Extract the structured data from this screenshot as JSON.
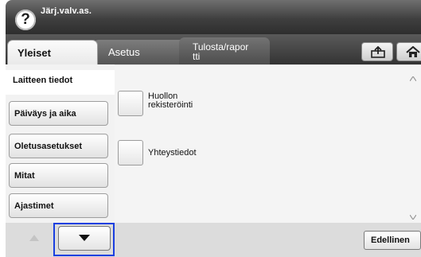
{
  "header": {
    "help_symbol": "?",
    "title": "Järj.valv.as."
  },
  "tabs": [
    {
      "label": "Yleiset",
      "selected": true
    },
    {
      "label": "Asetus"
    },
    {
      "label_line1": "Tulosta/rapor",
      "label_line2": "tti"
    }
  ],
  "toolbar": {
    "icons": [
      "export-tray-icon",
      "home-icon"
    ]
  },
  "menu": {
    "items": [
      {
        "label": "Laitteen tiedot",
        "selected": true
      },
      {
        "label": "Päiväys ja aika"
      },
      {
        "label": "Oletusasetukset"
      },
      {
        "label": "Mitat"
      },
      {
        "label": "Ajastimet"
      }
    ]
  },
  "content": {
    "items": [
      {
        "line1": "Huollon",
        "line2": "rekisteröinti"
      },
      {
        "line1": "Yhteystiedot"
      }
    ]
  },
  "scroll": {
    "up_icon": "arrow-up-icon",
    "down_icon": "arrow-down-icon",
    "highlight_color": "#1a3fe0"
  },
  "footer": {
    "back_label": "Edellinen"
  }
}
